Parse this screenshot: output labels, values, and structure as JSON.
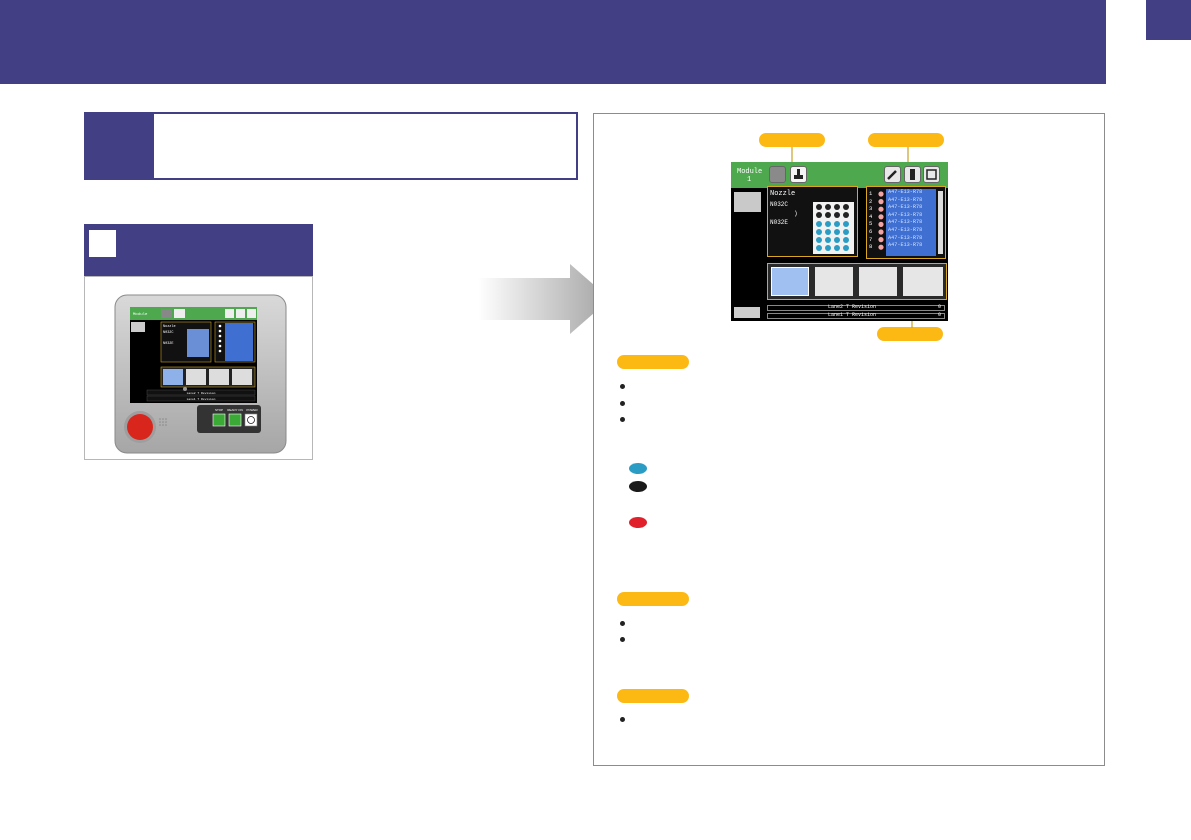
{
  "header": {
    "title": ""
  },
  "section": {
    "number": "",
    "title": ""
  },
  "subsection": {
    "number": "",
    "title": ""
  },
  "device_photo": {
    "screen_labels": [
      "Module",
      "Nozzle",
      "N032C",
      "N032E"
    ],
    "status_lines": [
      "Lane2 T Revision",
      "Lane1 T Revision"
    ],
    "button_labels": [
      "STOP",
      "READY ON",
      "POWER"
    ],
    "stop_button_color": "#d9261c"
  },
  "screen": {
    "module_label": "Module",
    "module_number": "1",
    "nozzle_header": "Nozzle",
    "nozzle_items": [
      "N032C",
      ")",
      "N032E"
    ],
    "list_numbers": [
      "1",
      "2",
      "3",
      "4",
      "5",
      "6",
      "7",
      "8"
    ],
    "list_rows": [
      "A47-E13-R78",
      "A47-E13-R78",
      "A47-E13-R78",
      "A47-E13-R78",
      "A47-E13-R78",
      "A47-E13-R78",
      "A47-E13-R78",
      "A47-E13-R78"
    ],
    "status_lines": [
      {
        "text": "Lane2 T Revision",
        "value": "0"
      },
      {
        "text": "Lane1 T Revision",
        "value": "0"
      }
    ]
  },
  "legend_dots": [
    {
      "color": "#2b9cc4"
    },
    {
      "color": "#1a1a1a"
    },
    {
      "color": "#e0202a"
    }
  ],
  "colors": {
    "brand": "#433f85",
    "highlight": "#fdb913",
    "screen_green": "#4ea84e"
  }
}
